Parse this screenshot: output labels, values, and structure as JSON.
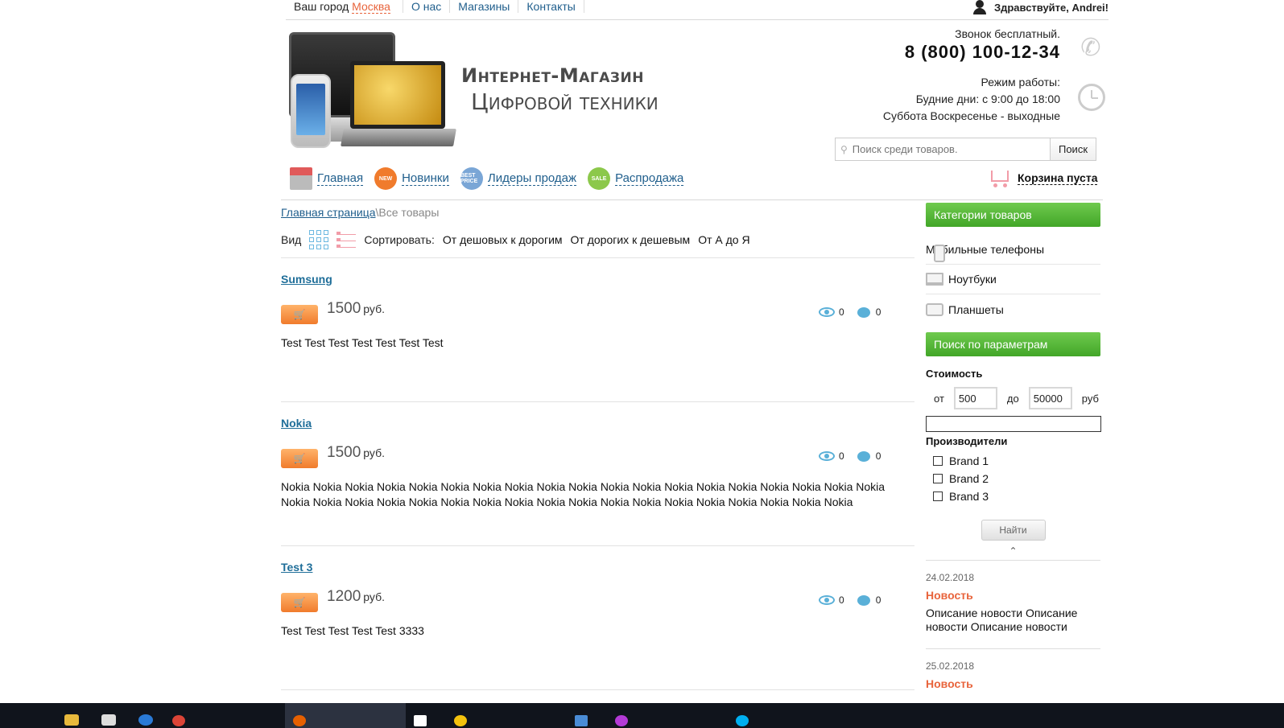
{
  "topbar": {
    "city_label": "Ваш город",
    "city": "Москва",
    "links": [
      "О нас",
      "Магазины",
      "Контакты"
    ],
    "greeting": "Здравствуйте, Andrei!"
  },
  "header": {
    "title_line1": "Интернет-Магазин",
    "title_line2": "Цифровой техники",
    "call_label": "Звонок бесплатный.",
    "phone": "8 (800) 100-12-34",
    "hours_label": "Режим работы:",
    "hours_weekdays": "Будние дни: с 9:00 до 18:00",
    "hours_weekend": "Суббота Воскресенье - выходные"
  },
  "search": {
    "placeholder": "Поиск среди товаров.",
    "button": "Поиск"
  },
  "nav": {
    "home": "Главная",
    "new": "Новинки",
    "leaders": "Лидеры продаж",
    "sale": "Распродажа",
    "new_badge": "NEW",
    "best_badge": "BEST PRICE",
    "sale_badge": "SALE"
  },
  "cart": {
    "label": "Корзина пуста"
  },
  "breadcrumb": {
    "home": "Главная страница",
    "sep": "\\",
    "current": "Все товары"
  },
  "viewbar": {
    "view_label": "Вид",
    "sort_label": "Сортировать:",
    "sort_options": [
      "От дешовых к дорогим",
      "От дорогих к дешевым",
      "От А до Я"
    ]
  },
  "products": [
    {
      "name": "Sumsung",
      "price": "1500",
      "currency": "руб.",
      "views": "0",
      "comments": "0",
      "description": "Test Test Test Test Test Test Test"
    },
    {
      "name": "Nokia",
      "price": "1500",
      "currency": "руб.",
      "views": "0",
      "comments": "0",
      "description": "Nokia Nokia Nokia Nokia Nokia Nokia Nokia Nokia Nokia Nokia Nokia Nokia Nokia Nokia Nokia Nokia Nokia Nokia Nokia Nokia Nokia Nokia Nokia Nokia Nokia Nokia Nokia Nokia Nokia Nokia Nokia Nokia Nokia Nokia Nokia Nokia Nokia"
    },
    {
      "name": "Test 3",
      "price": "1200",
      "currency": "руб.",
      "views": "0",
      "comments": "0",
      "description": "Test Test Test Test Test 3333"
    }
  ],
  "sidebar": {
    "categories_title": "Категории товаров",
    "categories": [
      "Мобильные телефоны",
      "Ноутбуки",
      "Планшеты"
    ],
    "params_title": "Поиск по параметрам",
    "cost_label": "Стоимость",
    "from_label": "от",
    "from_value": "500",
    "to_label": "до",
    "to_value": "50000",
    "currency": "руб",
    "makers_label": "Производители",
    "brands": [
      "Brand 1",
      "Brand 2",
      "Brand 3"
    ],
    "find_button": "Найти",
    "news": [
      {
        "date": "24.02.2018",
        "title": "Новость",
        "text": "Описание новости Описание новости Описание новости"
      },
      {
        "date": "25.02.2018",
        "title": "Новость"
      }
    ]
  },
  "colors": {
    "accent_orange": "#e8643c",
    "link_blue": "#1f5e8c",
    "green_header": "#42a628"
  }
}
